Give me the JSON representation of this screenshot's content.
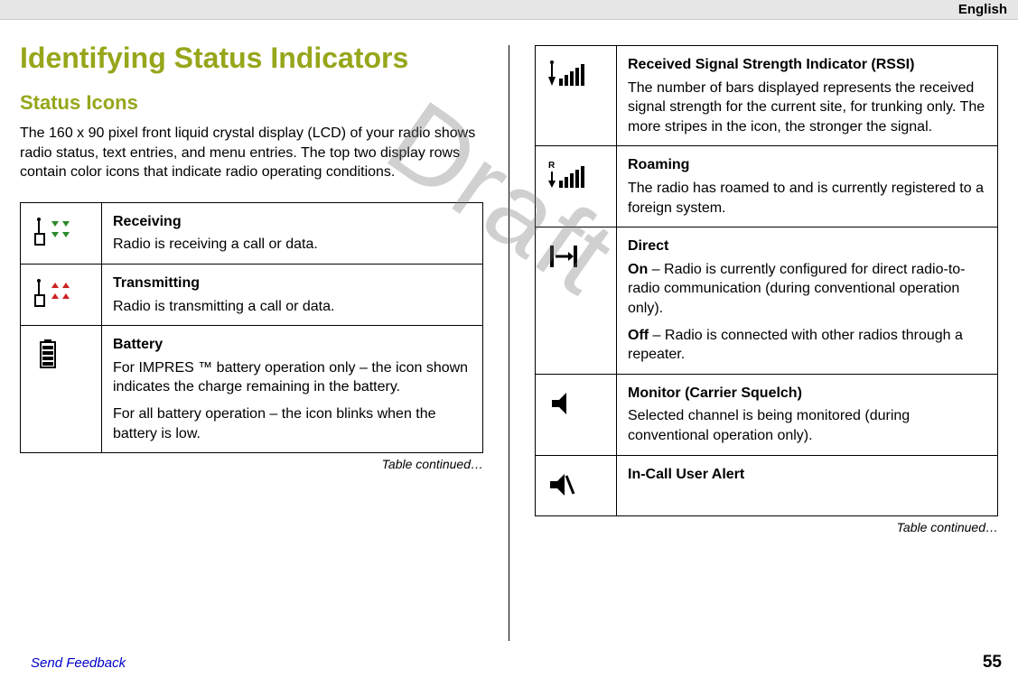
{
  "header": {
    "language": "English"
  },
  "content": {
    "h1": "Identifying Status Indicators",
    "h2": "Status Icons",
    "intro": "The 160 x 90 pixel front liquid crystal display (LCD) of your radio shows radio status, text entries, and menu entries. The top two display rows contain color icons that indicate radio operating conditions."
  },
  "left_table": {
    "rows": [
      {
        "icon": "receiving",
        "title": "Receiving",
        "paras": [
          "Radio is receiving a call or data."
        ]
      },
      {
        "icon": "transmitting",
        "title": "Transmitting",
        "paras": [
          "Radio is transmitting a call or data."
        ]
      },
      {
        "icon": "battery",
        "title": "Battery",
        "paras": [
          "For IMPRES ™ battery operation only – the icon shown indicates the charge remaining in the battery.",
          "For all battery operation – the icon blinks when the battery is low."
        ]
      }
    ],
    "continued": "Table continued…"
  },
  "right_table": {
    "rows": [
      {
        "icon": "rssi",
        "title": "Received Signal Strength Indicator (RSSI)",
        "paras": [
          "The number of bars displayed represents the received signal strength for the current site, for trunking only. The more stripes in the icon, the stronger the signal."
        ]
      },
      {
        "icon": "roaming",
        "title": "Roaming",
        "paras": [
          "The radio has roamed to and is currently registered to a foreign system."
        ]
      },
      {
        "icon": "direct",
        "title": "Direct",
        "paras_html": "<b>On</b> – Radio is currently configured for direct radio-to-radio communication (during conventional operation only).|||<b>Off</b> – Radio is connected with other radios through a repeater."
      },
      {
        "icon": "monitor",
        "title": "Monitor (Carrier Squelch)",
        "paras": [
          "Selected channel is being monitored (during conventional operation only)."
        ]
      },
      {
        "icon": "incall",
        "title": "In-Call User Alert",
        "paras": []
      }
    ],
    "continued": "Table continued…"
  },
  "footer": {
    "feedback": "Send Feedback",
    "page": "55"
  },
  "watermark": "Draft"
}
